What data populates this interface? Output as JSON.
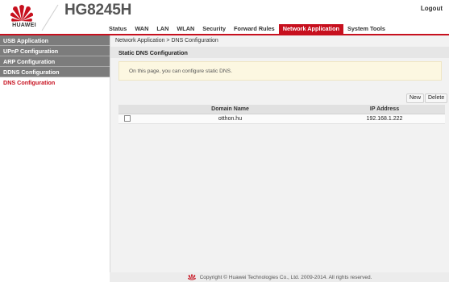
{
  "header": {
    "brand": "HUAWEI",
    "model": "HG8245H",
    "logout_label": "Logout",
    "accent_color": "#c7101e"
  },
  "nav": {
    "items": [
      {
        "label": "Status"
      },
      {
        "label": "WAN"
      },
      {
        "label": "LAN"
      },
      {
        "label": "WLAN"
      },
      {
        "label": "Security"
      },
      {
        "label": "Forward Rules"
      },
      {
        "label": "Network Application",
        "active": true
      },
      {
        "label": "System Tools"
      }
    ]
  },
  "sidebar": {
    "items": [
      {
        "label": "USB Application"
      },
      {
        "label": "UPnP Configuration"
      },
      {
        "label": "ARP Configuration"
      },
      {
        "label": "DDNS Configuration"
      },
      {
        "label": "DNS Configuration",
        "active": true
      }
    ]
  },
  "main": {
    "breadcrumb": "Network Application > DNS Configuration",
    "section_title": "Static DNS Configuration",
    "info_text": "On this page, you can configure static DNS.",
    "buttons": {
      "new_label": "New",
      "delete_label": "Delete"
    },
    "table": {
      "headers": [
        "",
        "Domain Name",
        "IP Address"
      ],
      "rows": [
        {
          "checked": false,
          "domain": "otthon.hu",
          "ip": "192.168.1.222"
        }
      ]
    }
  },
  "footer": {
    "text": "Copyright © Huawei Technologies Co., Ltd. 2009-2014. All rights reserved."
  },
  "icons": {
    "logo": "huawei-logo-icon",
    "checkbox": "checkbox-icon"
  }
}
